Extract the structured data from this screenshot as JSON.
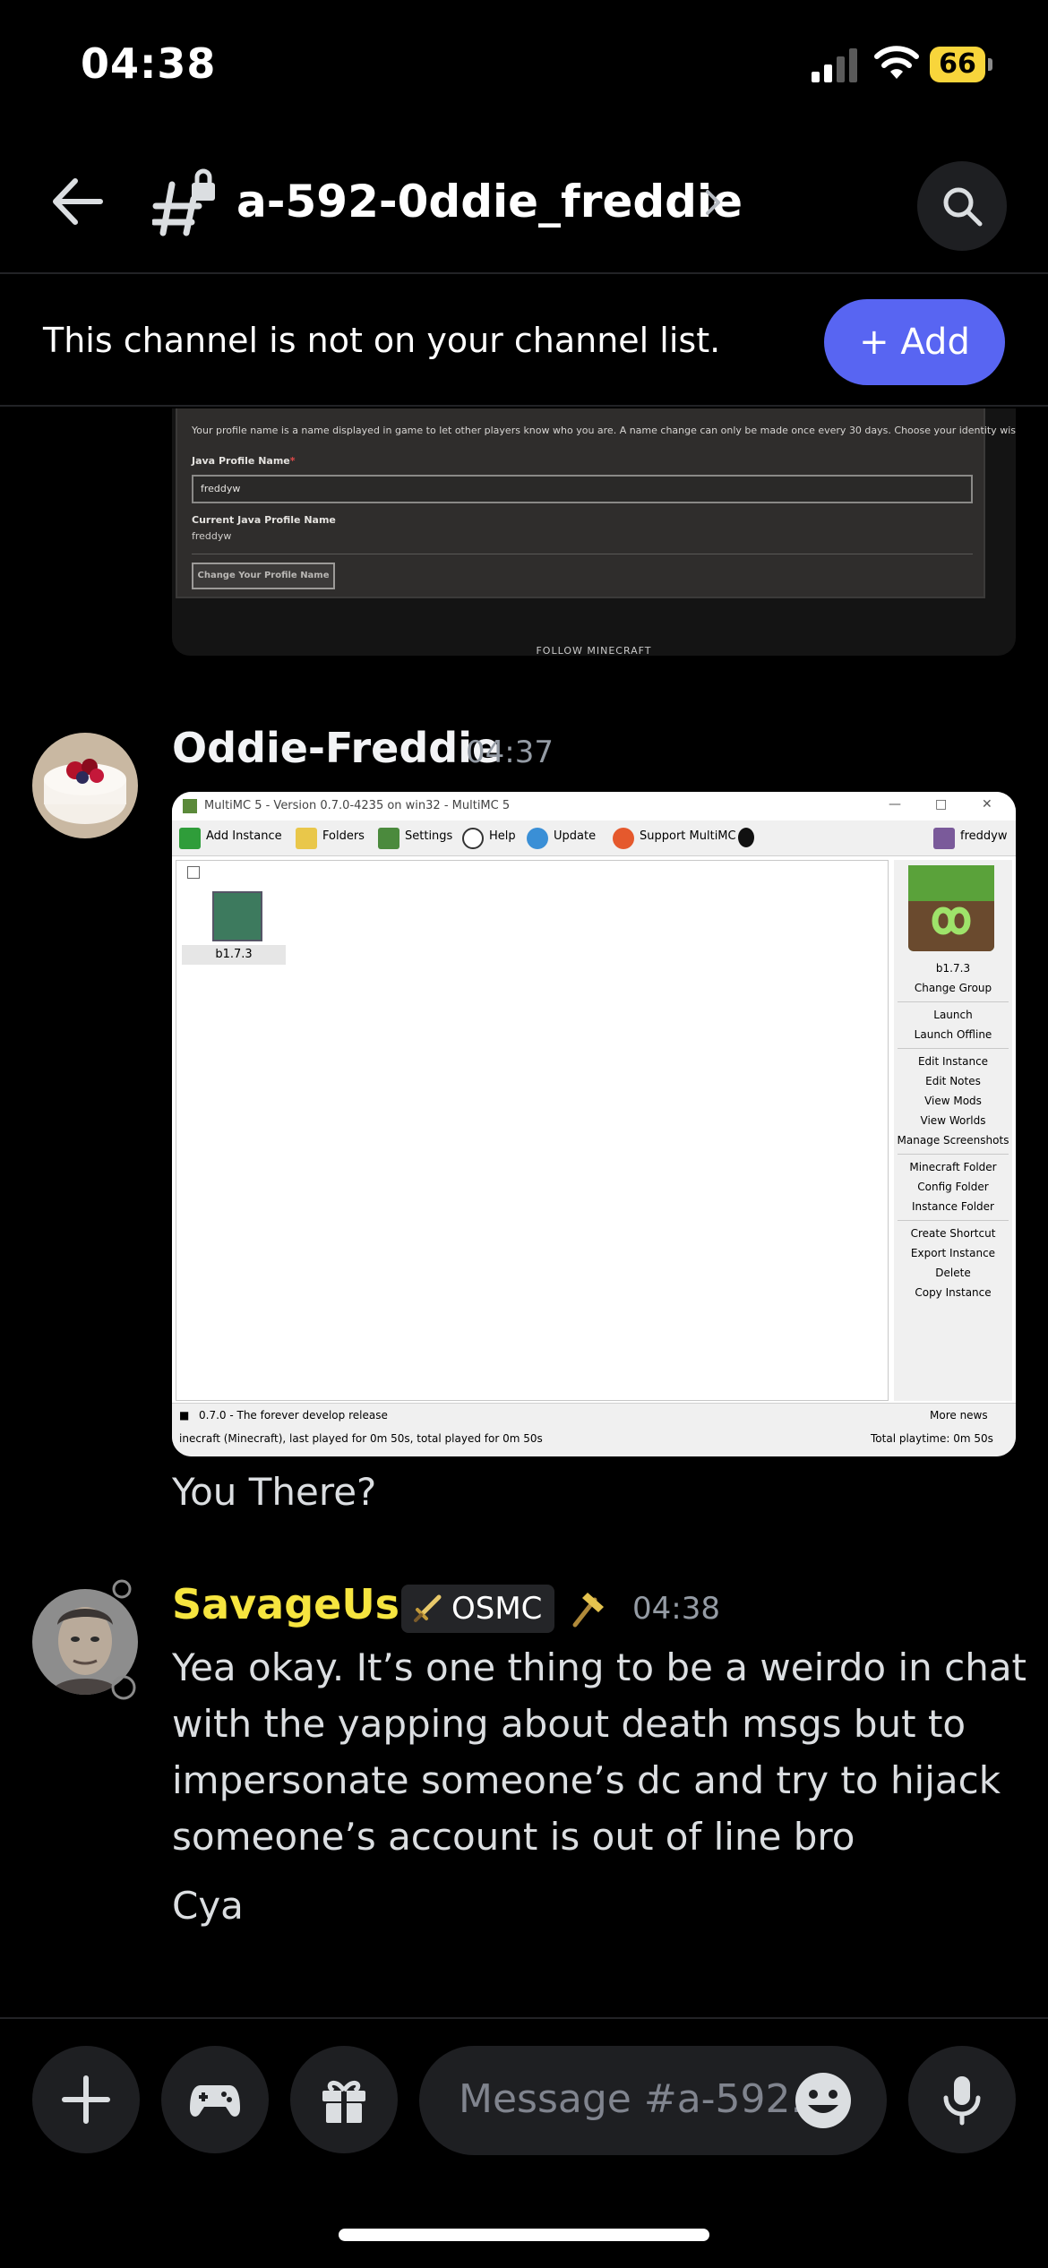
{
  "status_bar": {
    "time": "04:38",
    "battery": "66"
  },
  "header": {
    "channel_name": "a-592-0ddie_freddie"
  },
  "banner": {
    "text": "This channel is not on your channel list.",
    "add_label": "+ Add"
  },
  "prev_embed": {
    "description": "Your profile name is a name displayed in game to let other players know who you are. A name change can only be made once every 30 days. Choose your identity wisely!",
    "field_label": "Java Profile Name",
    "required_mark": "*",
    "field_value": "freddyw",
    "current_label": "Current Java Profile Name",
    "current_value": "freddyw",
    "change_button": "Change Your Profile Name",
    "footer": "FOLLOW MINECRAFT"
  },
  "messages": [
    {
      "username": "Oddie-Freddie",
      "time": "04:37",
      "username_color": "#f2f3f5",
      "text": "You There?"
    },
    {
      "username": "SavageUser",
      "time": "04:38",
      "username_color": "#f6e53f",
      "role_tag": "OSMC",
      "lines": [
        "Yea okay. It’s one thing to be a weirdo in chat",
        "with the yapping about death msgs but to",
        "impersonate someone’s dc and try to hijack",
        "someone’s account is out of line bro"
      ],
      "followup": "Cya"
    }
  ],
  "multimc": {
    "title": "MultiMC 5 - Version 0.7.0-4235 on win32 - MultiMC 5",
    "toolbar": [
      "Add Instance",
      "Folders",
      "Settings",
      "Help",
      "Update",
      "Support MultiMC"
    ],
    "account": "freddyw",
    "instance": "b1.7.3",
    "side_header": "b1.7.3",
    "side_items": [
      "Change Group",
      "Launch",
      "Launch Offline",
      "Edit Instance",
      "Edit Notes",
      "View Mods",
      "View Worlds",
      "Manage Screenshots",
      "Minecraft Folder",
      "Config Folder",
      "Instance Folder",
      "Create Shortcut",
      "Export Instance",
      "Delete",
      "Copy Instance"
    ],
    "status_left": "0.7.0 - The forever develop release",
    "status_right": "More news",
    "status_bottom_left": "inecraft  (Minecraft), last played for 0m 50s, total played for 0m 50s",
    "status_bottom_right": "Total playtime: 0m 50s"
  },
  "composer": {
    "placeholder": "Message #a-592..."
  },
  "colors": {
    "accent": "#5865f2",
    "background": "#000000",
    "surface": "#1e1f22",
    "battery": "#f8d53b"
  }
}
